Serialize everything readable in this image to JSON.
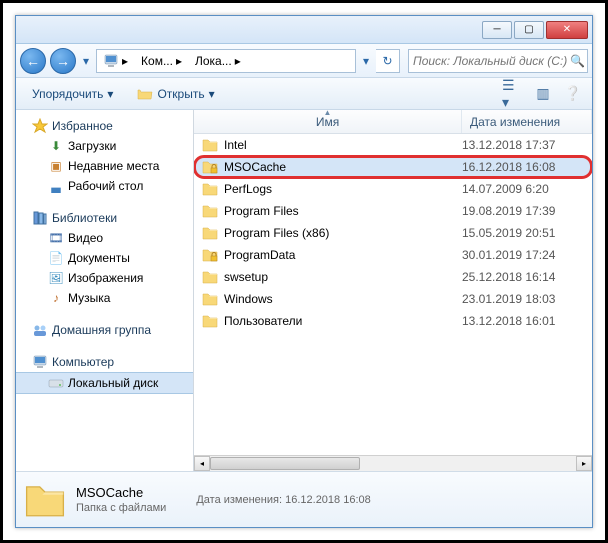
{
  "window": {
    "min_tip": "Свернуть",
    "max_tip": "Развернуть",
    "close_tip": "Закрыть"
  },
  "nav": {
    "back_tip": "Назад",
    "fwd_tip": "Вперёд",
    "breadcrumb": [
      {
        "label": "Ком..."
      },
      {
        "label": "Лока..."
      }
    ],
    "refresh_tip": "Обновить"
  },
  "search": {
    "placeholder": "Поиск: Локальный диск (C:)"
  },
  "toolbar": {
    "organize": "Упорядочить",
    "open": "Открыть"
  },
  "sidebar": {
    "favorites": {
      "label": "Избранное",
      "items": [
        {
          "label": "Загрузки",
          "icon": "downloads"
        },
        {
          "label": "Недавние места",
          "icon": "recent"
        },
        {
          "label": "Рабочий стол",
          "icon": "desktop"
        }
      ]
    },
    "libraries": {
      "label": "Библиотеки",
      "items": [
        {
          "label": "Видео",
          "icon": "video"
        },
        {
          "label": "Документы",
          "icon": "documents"
        },
        {
          "label": "Изображения",
          "icon": "pictures"
        },
        {
          "label": "Музыка",
          "icon": "music"
        }
      ]
    },
    "homegroup": {
      "label": "Домашняя группа"
    },
    "computer": {
      "label": "Компьютер",
      "items": [
        {
          "label": "Локальный диск",
          "icon": "drive",
          "selected": true
        }
      ]
    }
  },
  "columns": {
    "name": "Имя",
    "date": "Дата изменения"
  },
  "files": [
    {
      "name": "Intel",
      "date": "13.12.2018 17:37",
      "lock": false
    },
    {
      "name": "MSOCache",
      "date": "16.12.2018 16:08",
      "lock": true,
      "selected": true,
      "highlighted": true
    },
    {
      "name": "PerfLogs",
      "date": "14.07.2009 6:20",
      "lock": false
    },
    {
      "name": "Program Files",
      "date": "19.08.2019 17:39",
      "lock": false
    },
    {
      "name": "Program Files (x86)",
      "date": "15.05.2019 20:51",
      "lock": false
    },
    {
      "name": "ProgramData",
      "date": "30.01.2019 17:24",
      "lock": true
    },
    {
      "name": "swsetup",
      "date": "25.12.2018 16:14",
      "lock": false
    },
    {
      "name": "Windows",
      "date": "23.01.2019 18:03",
      "lock": false
    },
    {
      "name": "Пользователи",
      "date": "13.12.2018 16:01",
      "lock": false
    }
  ],
  "details": {
    "name": "MSOCache",
    "type": "Папка с файлами",
    "meta_label": "Дата изменения:",
    "meta_value": "16.12.2018 16:08"
  }
}
